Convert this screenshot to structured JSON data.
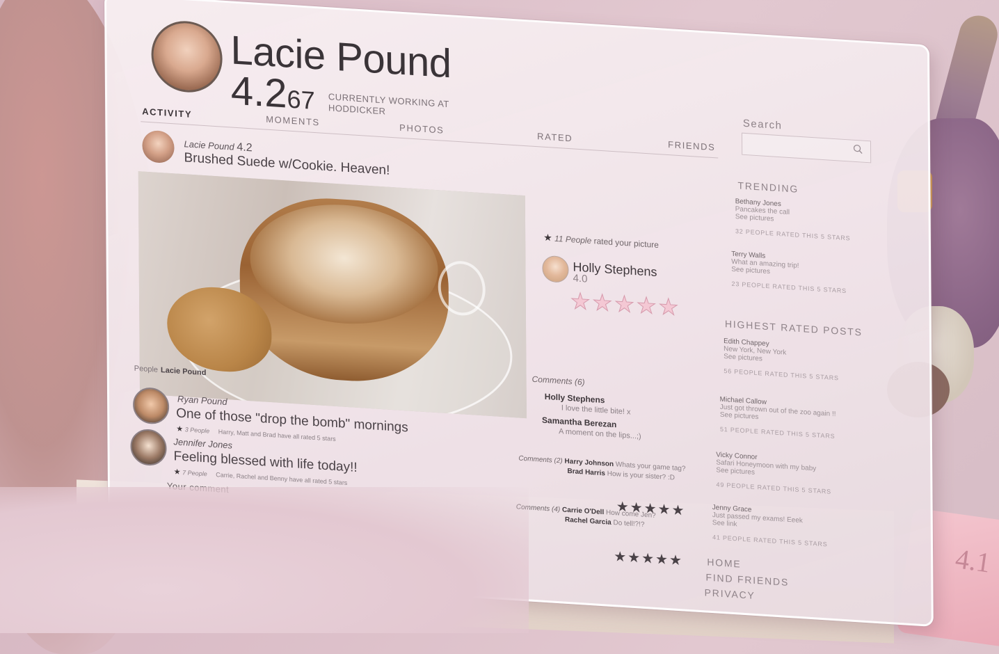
{
  "profile": {
    "name": "Lacie Pound",
    "score_main": "4.2",
    "score_decimals": "67",
    "status": "CURRENTLY WORKING AT HODDICKER"
  },
  "search": {
    "label": "Search",
    "placeholder": ""
  },
  "tabs": [
    {
      "label": "ACTIVITY"
    },
    {
      "label": "MOMENTS"
    },
    {
      "label": "PHOTOS"
    },
    {
      "label": "RATED"
    },
    {
      "label": "FRIENDS"
    }
  ],
  "post": {
    "author": "Lacie Pound",
    "author_score": "4.2",
    "text": "Brushed Suede w/Cookie. Heaven!",
    "photo_caption_label": "People",
    "photo_caption_name": "Lacie Pound"
  },
  "rating": {
    "count_text": "11 People",
    "count_suffix": "rated your picture",
    "rater_name": "Holly Stephens",
    "rater_score": "4.0",
    "stars": "★★★★★"
  },
  "comments": {
    "title": "Comments (6)",
    "items": [
      {
        "name": "Holly Stephens",
        "text": "I love the little bite! x"
      },
      {
        "name": "Samantha Berezan",
        "text": "A moment on the lips...;)"
      }
    ]
  },
  "feed": [
    {
      "author": "Ryan Pound",
      "text": "One of those \"drop the bomb\" mornings",
      "count": "3 People",
      "meta": "Harry, Matt and Brad have all rated 5 stars",
      "comments_label": "Comments (2)",
      "c1_name": "Harry Johnson",
      "c1_text": "Whats your game tag?",
      "c2_name": "Brad Harris",
      "c2_text": "How is your sister? :D",
      "stars": "★★★★★"
    },
    {
      "author": "Jennifer Jones",
      "text": "Feeling blessed with life today!!",
      "count": "7 People",
      "meta": "Carrie, Rachel and Benny have all rated 5 stars",
      "comments_label": "Comments (4)",
      "c1_name": "Carrie O'Dell",
      "c1_text": "How come Jen?",
      "c2_name": "Rachel Garcia",
      "c2_text": "Do tell!?!?",
      "stars": "★★★★★"
    }
  ],
  "comment_input_label": "Your comment",
  "sidebar": {
    "trending_heading": "TRENDING",
    "trending": [
      {
        "name": "Bethany Jones",
        "line": "Pancakes the call",
        "link": "See pictures",
        "rated": "32 PEOPLE RATED THIS 5 STARS"
      },
      {
        "name": "Terry Walls",
        "line": "What an amazing trip!",
        "link": "See pictures",
        "rated": "23 PEOPLE RATED THIS 5 STARS"
      }
    ],
    "highest_heading": "HIGHEST RATED POSTS",
    "highest": [
      {
        "name": "Edith Chappey",
        "line": "New York, New York",
        "link": "See pictures",
        "rated": "56 PEOPLE RATED THIS 5 STARS"
      },
      {
        "name": "Michael Callow",
        "line": "Just got thrown out of the zoo again !!",
        "link": "See pictures",
        "rated": "51 PEOPLE RATED THIS 5 STARS"
      },
      {
        "name": "Vicky Connor",
        "line": "Safari Honeymoon with my baby",
        "link": "See pictures",
        "rated": "49 PEOPLE RATED THIS 5 STARS"
      },
      {
        "name": "Jenny Grace",
        "line": "Just passed my exams! Eeek",
        "link": "See link",
        "rated": "41 PEOPLE RATED THIS 5 STARS"
      }
    ]
  },
  "footer_nav": [
    "HOME",
    "FIND FRIENDS",
    "PRIVACY"
  ],
  "card_number": "4.1",
  "colors": {
    "star_pink": "#f4c8d4",
    "text_dark": "#3a3438",
    "panel": "#f2e6ea"
  },
  "icons": [
    "search-icon",
    "star-icon"
  ]
}
